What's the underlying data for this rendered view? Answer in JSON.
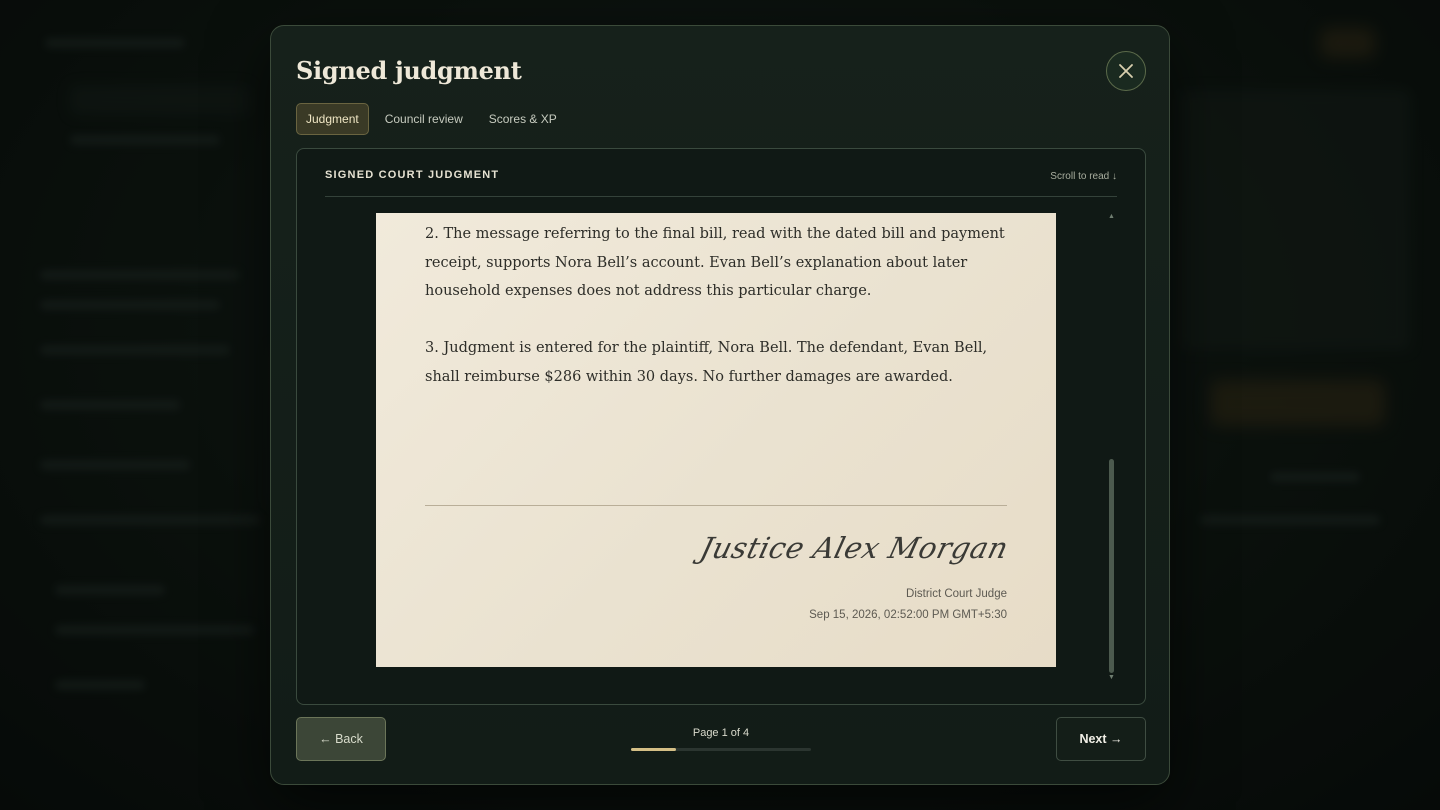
{
  "modal": {
    "title": "Signed judgment",
    "close_icon": "close-icon",
    "tabs": [
      {
        "label": "Judgment",
        "active": true
      },
      {
        "label": "Council review",
        "active": false
      },
      {
        "label": "Scores & XP",
        "active": false
      }
    ]
  },
  "document": {
    "header_title": "SIGNED COURT JUDGMENT",
    "scroll_hint": "Scroll to read ↓",
    "paragraphs": [
      "2. The message referring to the final bill, read with the dated bill and payment receipt, supports Nora Bell’s account. Evan Bell’s explanation about later household expenses does not address this particular charge.",
      "3. Judgment is entered for the plaintiff, Nora Bell. The defendant, Evan Bell, shall reimburse $286 within 30 days. No further damages are awarded."
    ],
    "signature": "Justice Alex Morgan",
    "judge_title": "District Court Judge",
    "signed_at": "Sep 15, 2026, 02:52:00 PM GMT+5:30"
  },
  "footer": {
    "back_label": "← Back",
    "next_label": "Next →",
    "page_indicator": "Page 1 of 4",
    "progress_fraction": 0.25
  },
  "colors": {
    "accent": "#d4bf86",
    "paper": "#eee6d5",
    "modal_bg": "#16211b"
  }
}
